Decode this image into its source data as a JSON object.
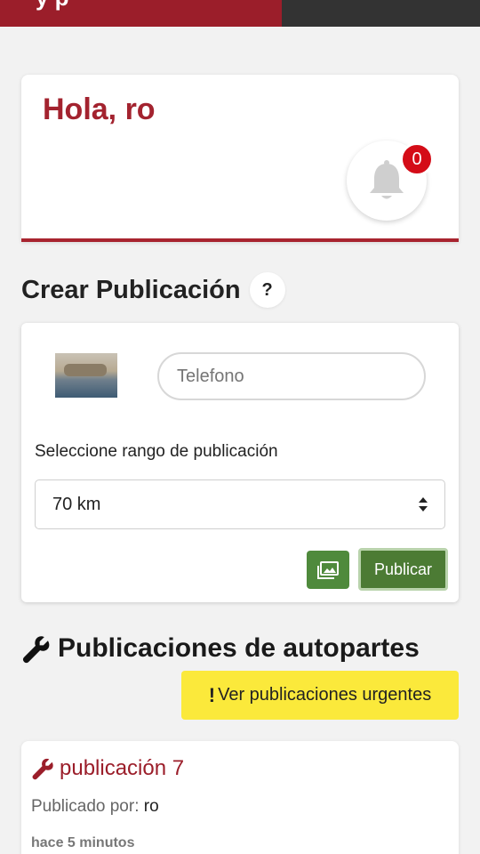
{
  "header": {
    "brand_fragment": "y     p"
  },
  "greeting": {
    "title": "Hola, ro",
    "notification_count": "0"
  },
  "create_section": {
    "title": "Crear Publicación",
    "help_label": "?",
    "phone_placeholder": "Telefono",
    "range_label": "Seleccione rango de publicación",
    "range_selected": "70 km",
    "publish_label": "Publicar"
  },
  "listing_section": {
    "title": "Publicaciones de autopartes",
    "urgent_label": "Ver publicaciones urgentes"
  },
  "publications": [
    {
      "title": "publicación 7",
      "by_label": "Publicado por:",
      "user": "ro",
      "time": "hace 5 minutos"
    }
  ],
  "colors": {
    "brand_red": "#9b1e2a",
    "green": "#4c7b34",
    "yellow": "#fbe93b",
    "badge_red": "#d40c17"
  },
  "icons": [
    "bell-icon",
    "image-icon",
    "wrench-icon",
    "sort-arrows-icon",
    "exclamation-icon"
  ]
}
